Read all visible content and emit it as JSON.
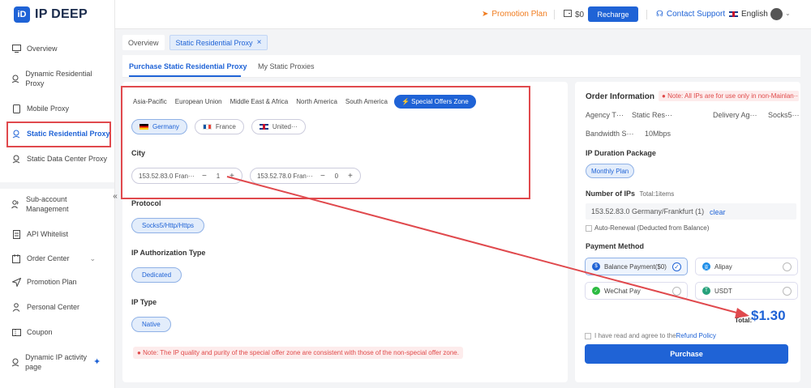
{
  "brand": {
    "mark": "iD",
    "name": "IP DEEP"
  },
  "sidebar": {
    "items": [
      {
        "label": "Overview"
      },
      {
        "label": "Dynamic Residential Proxy"
      },
      {
        "label": "Mobile Proxy"
      },
      {
        "label": "Static Residential Proxy"
      },
      {
        "label": "Static Data Center Proxy"
      },
      {
        "label": "Sub-account Management"
      },
      {
        "label": "API Whitelist"
      },
      {
        "label": "Order Center"
      },
      {
        "label": "Promotion Plan"
      },
      {
        "label": "Personal Center"
      },
      {
        "label": "Coupon"
      },
      {
        "label": "Dynamic IP activity page"
      }
    ],
    "collapse_icon": "«"
  },
  "header": {
    "promotion": "Promotion Plan",
    "balance": "$0",
    "recharge": "Recharge",
    "contact": "Contact Support",
    "language": "English"
  },
  "tabs": {
    "overview": "Overview",
    "current": "Static Residential Proxy",
    "close": "×"
  },
  "subtabs": {
    "purchase": "Purchase Static Residential Proxy",
    "mine": "My Static Proxies"
  },
  "regions": [
    "Asia-Pacific",
    "European Union",
    "Middle East & Africa",
    "North America",
    "South America"
  ],
  "special_zone": "Special Offers Zone",
  "countries": [
    "Germany",
    "France",
    "United···"
  ],
  "city_label": "City",
  "cities": [
    {
      "name": "153.52.83.0 Fran···",
      "qty": "1"
    },
    {
      "name": "153.52.78.0 Fran···",
      "qty": "0"
    }
  ],
  "protocol": {
    "label": "Protocol",
    "value": "Socks5/Http/Https"
  },
  "auth": {
    "label": "IP Authorization Type",
    "value": "Dedicated"
  },
  "iptype": {
    "label": "IP Type",
    "value": "Native"
  },
  "note": "Note: The IP quality and purity of the special offer zone are consistent with those of the non-special offer zone.",
  "order": {
    "title": "Order Information",
    "warning": "Note: All IPs are for use only in non-Mainlan···",
    "agency": "Agency T···",
    "static_res": "Static Res···",
    "delivery": "Delivery Ag···",
    "socks": "Socks5···",
    "bandwidth_label": "Bandwidth S···",
    "bandwidth_value": "10Mbps",
    "duration_label": "IP Duration Package",
    "duration_value": "Monthly Plan",
    "num_label": "Number of IPs",
    "num_total": "Total:1items",
    "ip_line": "153.52.83.0 Germany/Frankfurt (1)",
    "clear": "clear",
    "auto_renew": "Auto-Renewal (Deducted from Balance)",
    "payment_label": "Payment Method",
    "payments": [
      "Balance Payment($0)",
      "Alipay",
      "WeChat Pay",
      "USDT"
    ],
    "total_label": "Total:",
    "total_value": "$1.30",
    "agree_text": "I have read and agree to the",
    "refund": "Refund Policy",
    "purchase": "Purchase"
  }
}
